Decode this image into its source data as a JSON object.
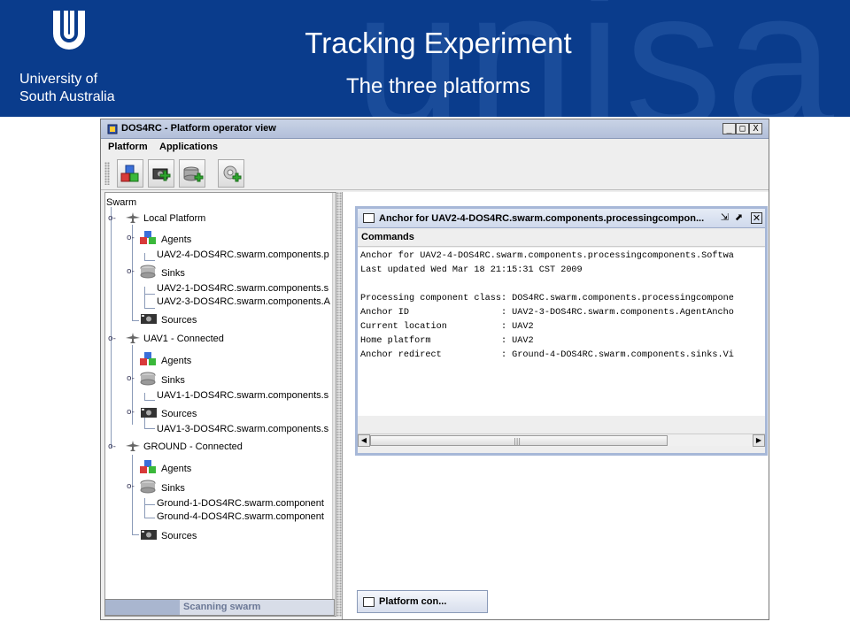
{
  "slide": {
    "title": "Tracking Experiment",
    "subtitle": "The three platforms",
    "logo_line1": "University of",
    "logo_line2": "South Australia",
    "watermark": "unisa"
  },
  "window": {
    "title": "DOS4RC - Platform operator view",
    "minimize": "_",
    "maximize": "□",
    "close": "X"
  },
  "menu": [
    "Platform",
    "Applications"
  ],
  "toolbar": {
    "buttons": [
      "add-agent-icon",
      "add-source-icon",
      "add-sink-icon",
      "add-platform-icon"
    ]
  },
  "tree": {
    "root": "Swarm",
    "platform1": "Local Platform",
    "p1_agents": "Agents",
    "p1_agent1": "UAV2-4-DOS4RC.swarm.components.p",
    "p1_sinks": "Sinks",
    "p1_sink1": "UAV2-1-DOS4RC.swarm.components.s",
    "p1_sink2": "UAV2-3-DOS4RC.swarm.components.A",
    "p1_sources": "Sources",
    "platform2": "UAV1 - Connected",
    "p2_agents": "Agents",
    "p2_sinks": "Sinks",
    "p2_sink1": "UAV1-1-DOS4RC.swarm.components.s",
    "p2_sources": "Sources",
    "p2_source1": "UAV1-3-DOS4RC.swarm.components.s",
    "platform3": "GROUND - Connected",
    "p3_agents": "Agents",
    "p3_sinks": "Sinks",
    "p3_sink1": "Ground-1-DOS4RC.swarm.component",
    "p3_sink2": "Ground-4-DOS4RC.swarm.component",
    "p3_sources": "Sources"
  },
  "status": "Scanning swarm",
  "internal_frame": {
    "title": "Anchor for UAV2-4-DOS4RC.swarm.components.processingcompon...",
    "menu": "Commands",
    "lines": [
      "Anchor for UAV2-4-DOS4RC.swarm.components.processingcomponents.Softwa",
      "Last updated Wed Mar 18 21:15:31 CST 2009",
      "",
      "Processing component class: DOS4RC.swarm.components.processingcompone",
      "Anchor ID                 : UAV2-3-DOS4RC.swarm.components.AgentAncho",
      "Current location          : UAV2",
      "Home platform             : UAV2",
      "Anchor redirect           : Ground-4-DOS4RC.swarm.components.sinks.Vi"
    ],
    "scroll_grip": "|||"
  },
  "taskbar_button": "Platform con..."
}
